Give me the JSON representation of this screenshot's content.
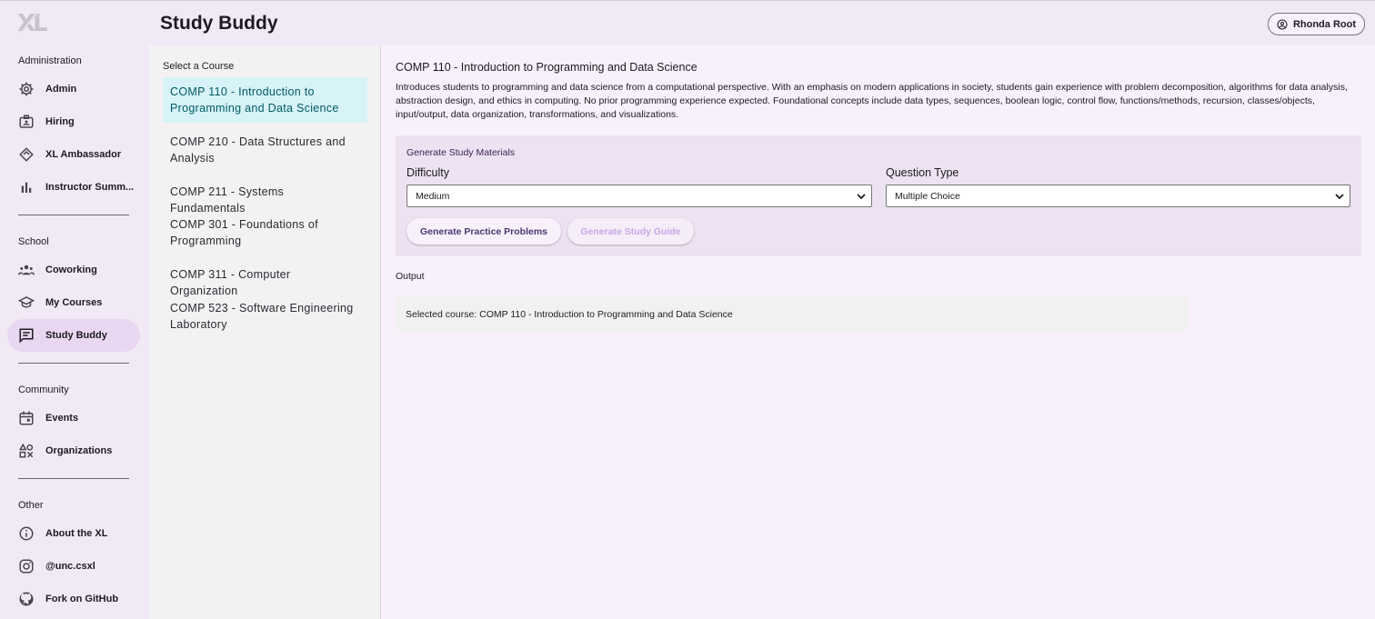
{
  "app": {
    "logo_text": "XL"
  },
  "header": {
    "title": "Study Buddy",
    "user_name": "Rhonda Root"
  },
  "sidebar": {
    "sections": [
      {
        "title": "Administration",
        "items": [
          {
            "label": "Admin",
            "icon": "gear-icon"
          },
          {
            "label": "Hiring",
            "icon": "badge-icon"
          },
          {
            "label": "XL Ambassador",
            "icon": "ambassador-icon"
          },
          {
            "label": "Instructor Summ...",
            "icon": "bar-chart-icon"
          }
        ]
      },
      {
        "title": "School",
        "items": [
          {
            "label": "Coworking",
            "icon": "people-icon"
          },
          {
            "label": "My Courses",
            "icon": "graduation-cap-icon"
          },
          {
            "label": "Study Buddy",
            "icon": "chat-icon",
            "active": true
          }
        ]
      },
      {
        "title": "Community",
        "items": [
          {
            "label": "Events",
            "icon": "calendar-icon"
          },
          {
            "label": "Organizations",
            "icon": "shapes-icon"
          }
        ]
      },
      {
        "title": "Other",
        "items": [
          {
            "label": "About the XL",
            "icon": "info-icon"
          },
          {
            "label": "@unc.csxl",
            "icon": "instagram-icon"
          },
          {
            "label": "Fork on GitHub",
            "icon": "github-icon"
          }
        ]
      }
    ]
  },
  "courses": {
    "title": "Select a Course",
    "items": [
      {
        "label": "COMP 110 - Introduction to Programming and Data Science",
        "active": true
      },
      {
        "label": "COMP 210 - Data Structures and Analysis"
      },
      {
        "label": "COMP 211 - Systems Fundamentals"
      },
      {
        "label": "COMP 301 - Foundations of Programming"
      },
      {
        "label": "COMP 311 - Computer Organization"
      },
      {
        "label": "COMP 523 - Software Engineering Laboratory"
      }
    ]
  },
  "main": {
    "course_title": "COMP 110 - Introduction to Programming and Data Science",
    "course_description": "Introduces students to programming and data science from a computational perspective. With an emphasis on modern applications in society, students gain experience with problem decomposition, algorithms for data analysis, abstraction design, and ethics in computing. No prior programming experience expected. Foundational concepts include data types, sequences, boolean logic, control flow, functions/methods, recursion, classes/objects, input/output, data organization, transformations, and visualizations.",
    "generate": {
      "title": "Generate Study Materials",
      "difficulty_label": "Difficulty",
      "difficulty_value": "Medium",
      "question_type_label": "Question Type",
      "question_type_value": "Multiple Choice",
      "practice_button": "Generate Practice Problems",
      "guide_button": "Generate Study Guide"
    },
    "output": {
      "label": "Output",
      "text": "Selected course: COMP 110 - Introduction to Programming and Data Science"
    }
  },
  "colors": {
    "accent": "#e9d7f1",
    "active_course_bg": "#d7f3f8",
    "active_course_text": "#005a64",
    "panel_bg": "#ede2f2"
  }
}
